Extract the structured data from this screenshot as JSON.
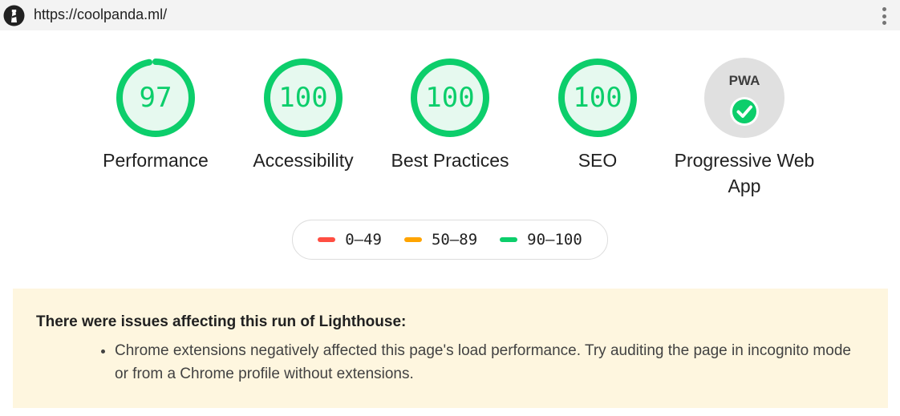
{
  "header": {
    "url": "https://coolpanda.ml/"
  },
  "colors": {
    "pass": "#0cce6b",
    "average": "#ffa400",
    "fail": "#ff4e42",
    "pwa_bg": "#e0e0e0"
  },
  "categories": [
    {
      "label": "Performance",
      "score": "97",
      "value": 97
    },
    {
      "label": "Accessibility",
      "score": "100",
      "value": 100
    },
    {
      "label": "Best Practices",
      "score": "100",
      "value": 100
    },
    {
      "label": "SEO",
      "score": "100",
      "value": 100
    }
  ],
  "pwa": {
    "badge": "PWA",
    "label": "Progressive Web App",
    "status_icon": "check-icon"
  },
  "legend": [
    {
      "range": "0–49",
      "color": "#ff4e42"
    },
    {
      "range": "50–89",
      "color": "#ffa400"
    },
    {
      "range": "90–100",
      "color": "#0cce6b"
    }
  ],
  "warning": {
    "title": "There were issues affecting this run of Lighthouse:",
    "items": [
      "Chrome extensions negatively affected this page's load performance. Try auditing the page in incognito mode or from a Chrome profile without extensions."
    ]
  }
}
